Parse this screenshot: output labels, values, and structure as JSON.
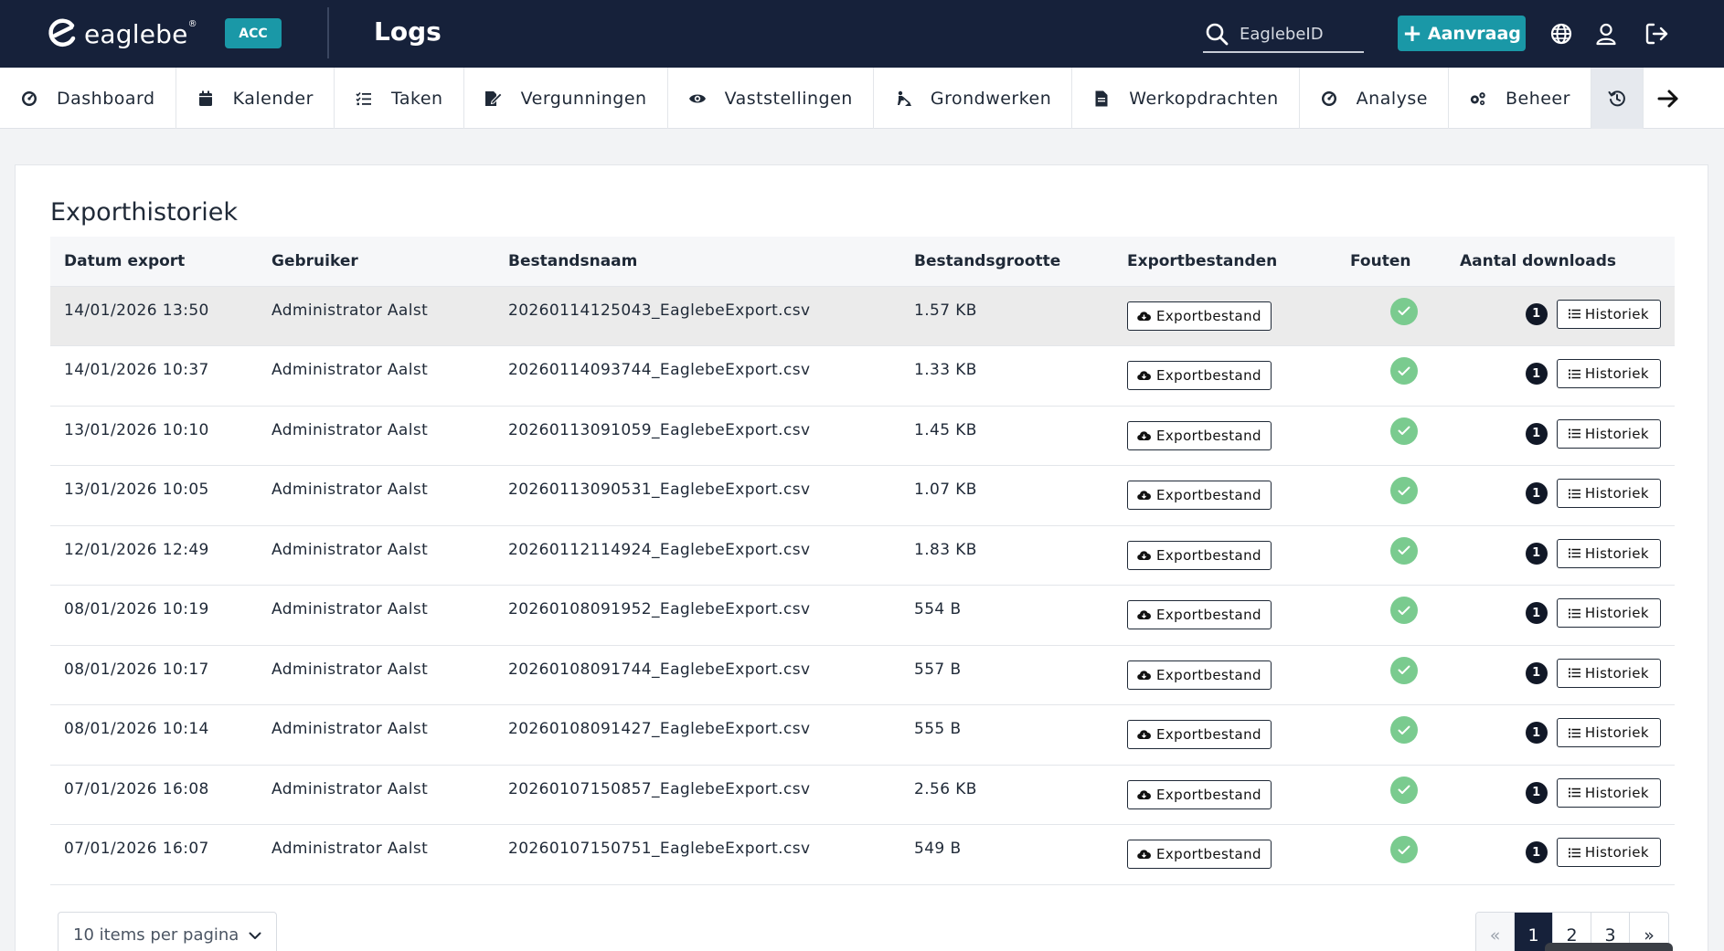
{
  "app": {
    "logo_text": "eaglebe",
    "logo_mark": "®",
    "env_badge": "ACC",
    "page_title": "Logs"
  },
  "header": {
    "search_placeholder": "EaglebeID",
    "aanvraag_label": "Aanvraag",
    "icons": [
      "search-icon",
      "globe-icon",
      "user-icon",
      "logout-icon"
    ]
  },
  "nav": {
    "items": [
      {
        "label": "Dashboard",
        "icon": "dashboard-icon"
      },
      {
        "label": "Kalender",
        "icon": "calendar-icon"
      },
      {
        "label": "Taken",
        "icon": "tasks-icon"
      },
      {
        "label": "Vergunningen",
        "icon": "permit-icon"
      },
      {
        "label": "Vaststellingen",
        "icon": "eye-icon"
      },
      {
        "label": "Grondwerken",
        "icon": "digging-icon"
      },
      {
        "label": "Werkopdrachten",
        "icon": "document-icon"
      },
      {
        "label": "Analyse",
        "icon": "analysis-icon"
      },
      {
        "label": "Beheer",
        "icon": "cogs-icon"
      }
    ],
    "active_icon": "history-icon"
  },
  "card": {
    "title": "Exporthistoriek"
  },
  "table": {
    "headers": {
      "datum": "Datum export",
      "gebruiker": "Gebruiker",
      "bestandsnaam": "Bestandsnaam",
      "grootte": "Bestandsgrootte",
      "export": "Exportbestanden",
      "fouten": "Fouten",
      "downloads": "Aantal downloads"
    },
    "export_button_label": "Exportbestand",
    "history_button_label": "Historiek",
    "rows": [
      {
        "datum": "14/01/2026 13:50",
        "gebruiker": "Administrator Aalst",
        "bestandsnaam": "20260114125043_EaglebeExport.csv",
        "grootte": "1.57 KB",
        "downloads": "1"
      },
      {
        "datum": "14/01/2026 10:37",
        "gebruiker": "Administrator Aalst",
        "bestandsnaam": "20260114093744_EaglebeExport.csv",
        "grootte": "1.33 KB",
        "downloads": "1"
      },
      {
        "datum": "13/01/2026 10:10",
        "gebruiker": "Administrator Aalst",
        "bestandsnaam": "20260113091059_EaglebeExport.csv",
        "grootte": "1.45 KB",
        "downloads": "1"
      },
      {
        "datum": "13/01/2026 10:05",
        "gebruiker": "Administrator Aalst",
        "bestandsnaam": "20260113090531_EaglebeExport.csv",
        "grootte": "1.07 KB",
        "downloads": "1"
      },
      {
        "datum": "12/01/2026 12:49",
        "gebruiker": "Administrator Aalst",
        "bestandsnaam": "20260112114924_EaglebeExport.csv",
        "grootte": "1.83 KB",
        "downloads": "1"
      },
      {
        "datum": "08/01/2026 10:19",
        "gebruiker": "Administrator Aalst",
        "bestandsnaam": "20260108091952_EaglebeExport.csv",
        "grootte": "554 B",
        "downloads": "1"
      },
      {
        "datum": "08/01/2026 10:17",
        "gebruiker": "Administrator Aalst",
        "bestandsnaam": "20260108091744_EaglebeExport.csv",
        "grootte": "557 B",
        "downloads": "1"
      },
      {
        "datum": "08/01/2026 10:14",
        "gebruiker": "Administrator Aalst",
        "bestandsnaam": "20260108091427_EaglebeExport.csv",
        "grootte": "555 B",
        "downloads": "1"
      },
      {
        "datum": "07/01/2026 16:08",
        "gebruiker": "Administrator Aalst",
        "bestandsnaam": "20260107150857_EaglebeExport.csv",
        "grootte": "2.56 KB",
        "downloads": "1"
      },
      {
        "datum": "07/01/2026 16:07",
        "gebruiker": "Administrator Aalst",
        "bestandsnaam": "20260107150751_EaglebeExport.csv",
        "grootte": "549 B",
        "downloads": "1"
      }
    ]
  },
  "footer": {
    "per_page_label": "10 items per pagina",
    "pages": [
      "«",
      "1",
      "2",
      "3",
      "»"
    ],
    "active_page": "1"
  },
  "colors": {
    "header_bg": "#16213a",
    "accent": "#1a98a7",
    "success": "#7acb8f"
  }
}
